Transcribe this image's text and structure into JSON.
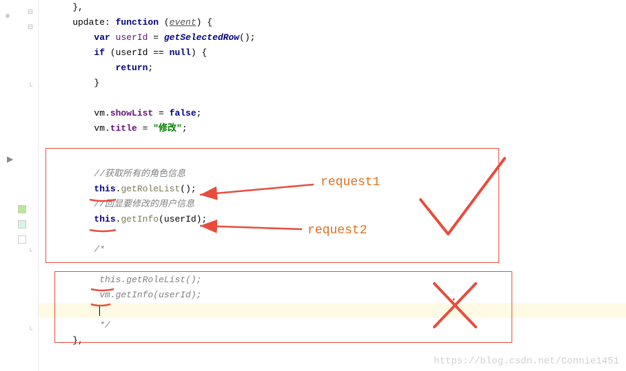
{
  "code": {
    "l1": "    },",
    "l2_a": "    update: ",
    "l2_b": "function",
    "l2_c": " (",
    "l2_d": "event",
    "l2_e": ") {",
    "l3_a": "        ",
    "l3_b": "var",
    "l3_c": " ",
    "l3_d": "userId",
    "l3_e": " = ",
    "l3_f": "getSelectedRow",
    "l3_g": "();",
    "l4_a": "        ",
    "l4_b": "if",
    "l4_c": " (userId == ",
    "l4_d": "null",
    "l4_e": ") {",
    "l5_a": "            ",
    "l5_b": "return",
    "l5_c": ";",
    "l6": "        }",
    "l7": "",
    "l8_a": "        vm.",
    "l8_b": "showList",
    "l8_c": " = ",
    "l8_d": "false",
    "l8_e": ";",
    "l9_a": "        vm.",
    "l9_b": "title",
    "l9_c": " = ",
    "l9_d": "\"修改\"",
    "l9_e": ";",
    "l10": "",
    "l11": "",
    "l12": "        //获取所有的角色信息",
    "l13_a": "        ",
    "l13_b": "this",
    "l13_c": ".",
    "l13_d": "getRoleList",
    "l13_e": "();",
    "l14": "        //回显要修改的用户信息",
    "l15_a": "        ",
    "l15_b": "this",
    "l15_c": ".",
    "l15_d": "getInfo",
    "l15_e": "(userId);",
    "l16": "",
    "l17": "        /*",
    "l18": "",
    "l19": "         this.getRoleList();",
    "l20": "         vm.getInfo(userId);",
    "l21": "         ",
    "l22": "         */",
    "l23": "    },"
  },
  "annotations": {
    "request1": "request1",
    "request2": "request2"
  },
  "watermark": "https://blog.csdn.net/Connie1451"
}
